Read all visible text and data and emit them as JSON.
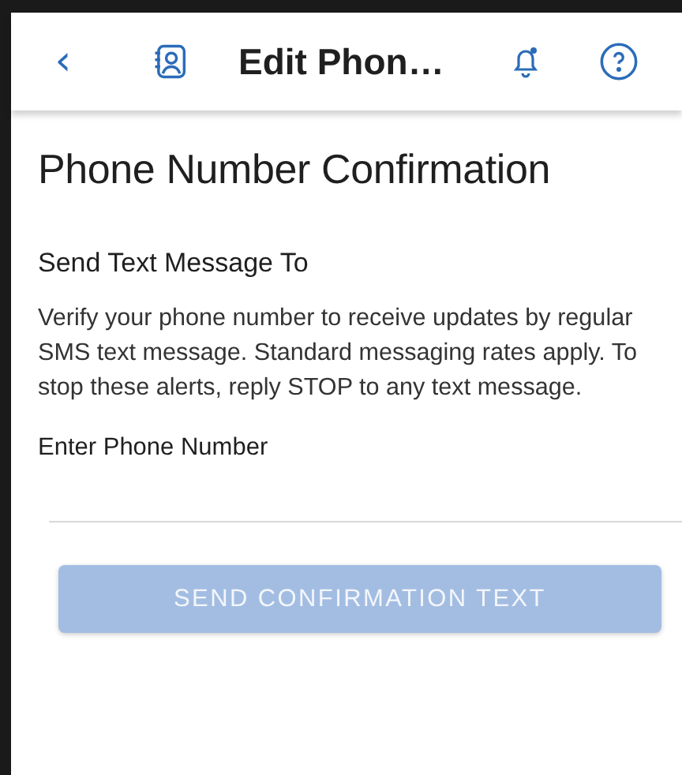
{
  "header": {
    "back": "‹",
    "title": "Edit Phon…"
  },
  "page": {
    "heading": "Phone Number Confirmation",
    "subheading": "Send Text Message To",
    "description": "Verify your phone number to receive updates by regular SMS text message. Standard messaging rates apply. To stop these alerts, reply STOP to any text message."
  },
  "phone_field": {
    "label": "Enter Phone Number"
  },
  "send_button": {
    "label": "SEND CONFIRMATION TEXT",
    "disabled": true
  }
}
